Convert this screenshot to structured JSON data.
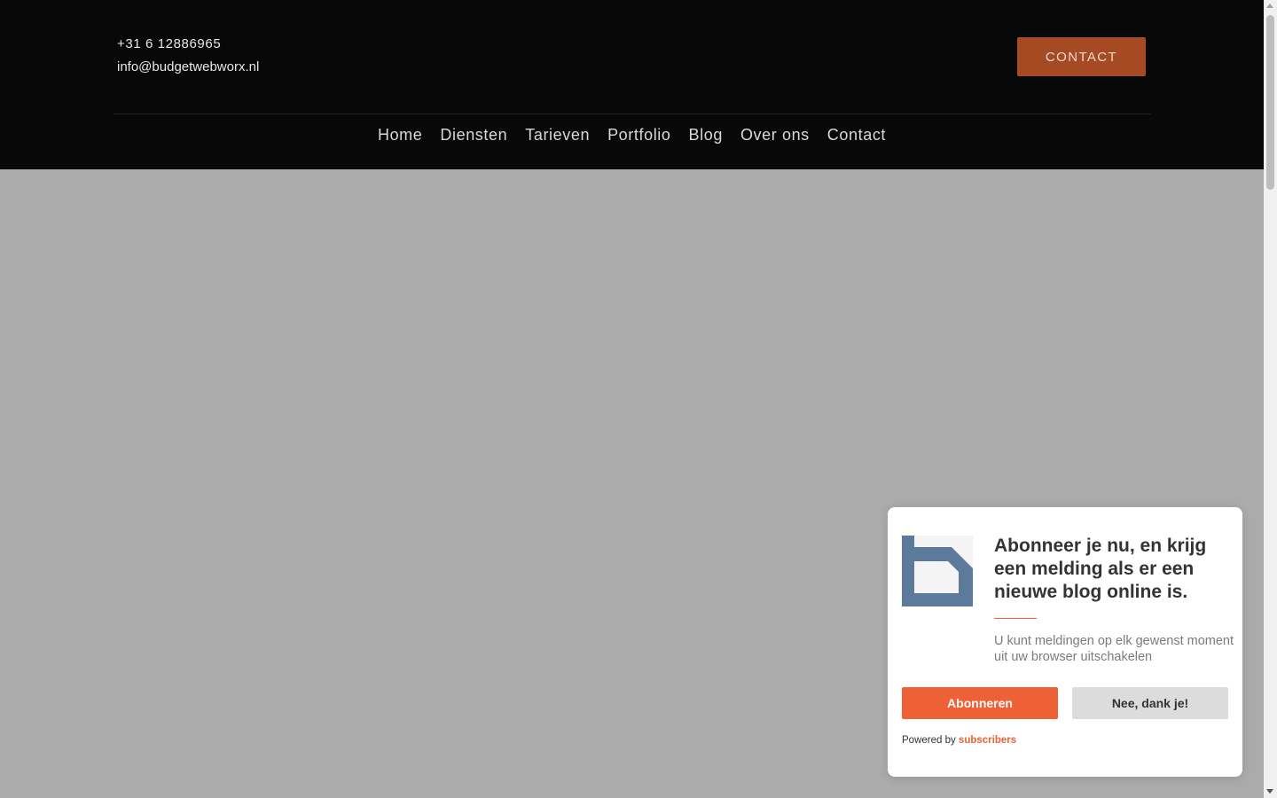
{
  "header": {
    "phone": "+31 6 12886965",
    "email": "info@budgetwebworx.nl",
    "contact_button": "CONTACT"
  },
  "nav": {
    "items": [
      {
        "label": "Home"
      },
      {
        "label": "Diensten"
      },
      {
        "label": "Tarieven"
      },
      {
        "label": "Portfolio"
      },
      {
        "label": "Blog"
      },
      {
        "label": "Over ons"
      },
      {
        "label": "Contact"
      }
    ]
  },
  "popup": {
    "logo_icon": "budgetwebworx-b-logo",
    "title": "Abonneer je nu, en krijg een melding als er een nieuwe blog online is.",
    "text": "U kunt meldingen op elk gewenst moment uit uw browser uitschakelen",
    "subscribe_label": "Abonneren",
    "decline_label": "Nee, dank je!",
    "powered_by": "Powered by",
    "powered_link": "subscribers"
  },
  "colors": {
    "header_bg": "#080808",
    "accent": "#ee6136",
    "contact_button_bg": "#a64a24",
    "logo_blue": "#5b7a9c",
    "overlay": "#ababab"
  }
}
